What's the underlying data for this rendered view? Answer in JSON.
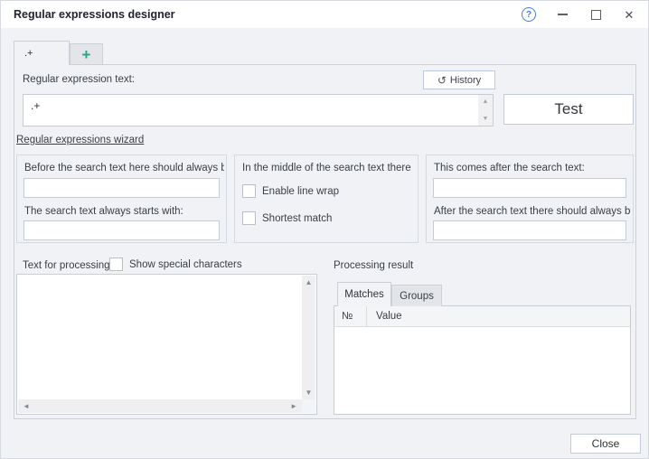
{
  "window": {
    "title": "Regular expressions designer"
  },
  "icons": {
    "help": "?",
    "close": "✕",
    "history": "↺",
    "add_tab": "+",
    "scroll_up": "▲",
    "scroll_down": "▼",
    "scroll_left": "◄",
    "scroll_right": "►"
  },
  "tabs": {
    "regex_tab_label": ".+"
  },
  "regex_section": {
    "label": "Regular expression text:",
    "history_button": "History",
    "value": ".+",
    "test_button": "Test",
    "wizard_link": "Regular expressions wizard"
  },
  "wizard_groups": {
    "before": {
      "label_top": "Before the search text here should always b",
      "value_top": "",
      "label_bottom": "The search text always starts with:",
      "value_bottom": ""
    },
    "middle": {
      "title": "In the middle of the search text there",
      "checkbox1": "Enable line wrap",
      "checkbox1_checked": false,
      "checkbox2": "Shortest match",
      "checkbox2_checked": false
    },
    "after": {
      "label_top": "This comes after the search text:",
      "value_top": "",
      "label_bottom": "After the search text there should always be",
      "value_bottom": ""
    }
  },
  "processing": {
    "input_label": "Text for processing",
    "show_special_label": "Show special characters",
    "show_special_checked": false,
    "input_value": "",
    "result_label": "Processing result",
    "result_tabs": [
      "Matches",
      "Groups"
    ],
    "table": {
      "columns": [
        "№",
        "Value"
      ],
      "rows": []
    }
  },
  "footer": {
    "close_button": "Close"
  },
  "colors": {
    "accent_teal": "#1ba98a",
    "help_blue": "#4a7ed2",
    "window_bg": "#f0f2f6"
  }
}
